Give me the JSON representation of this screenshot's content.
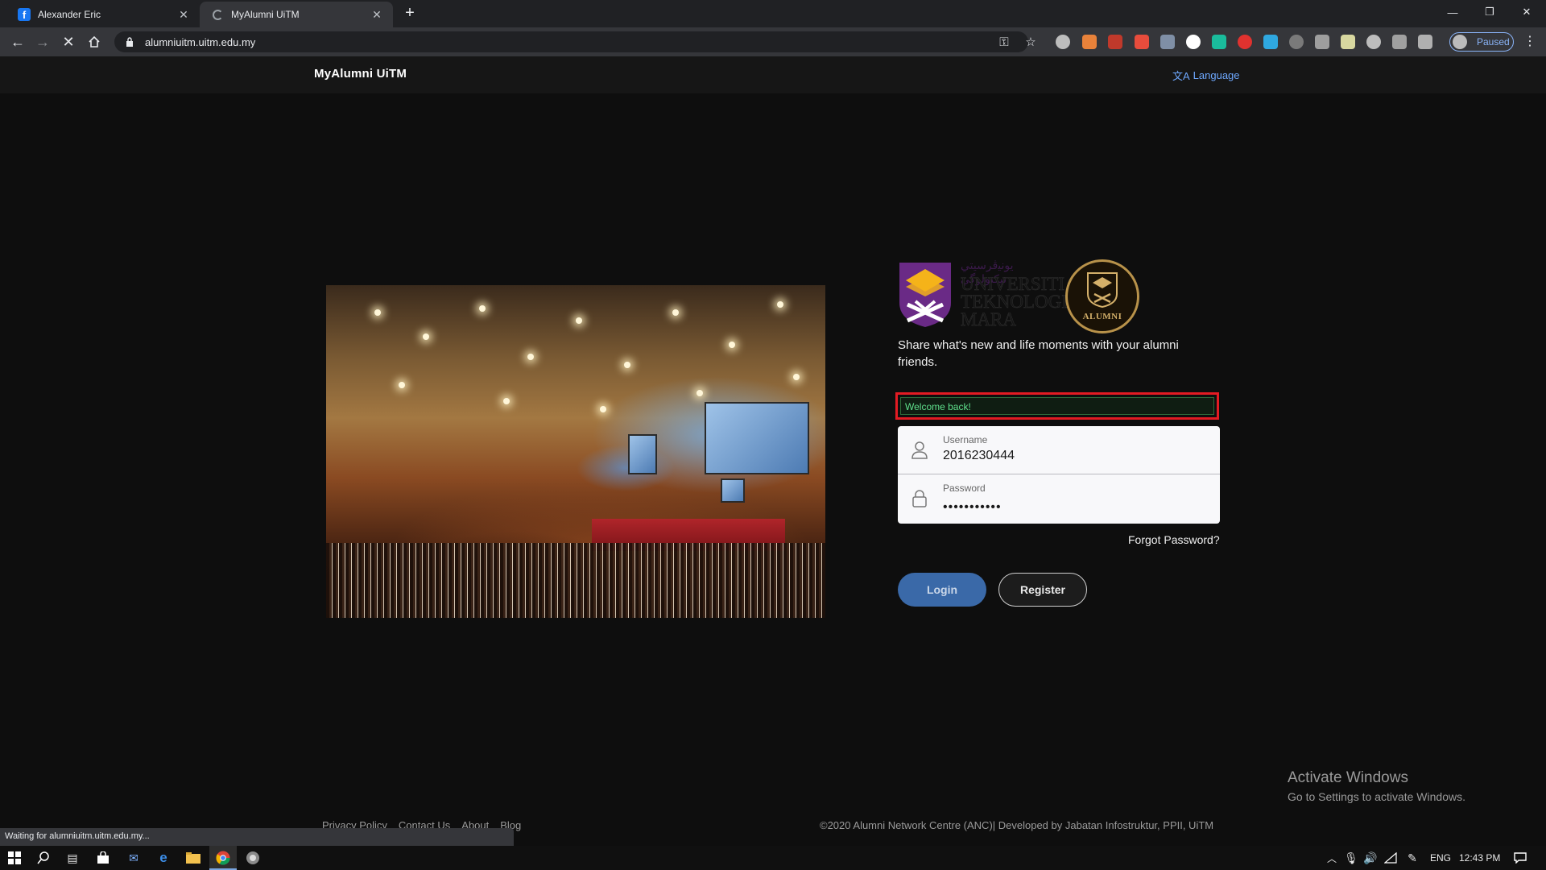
{
  "browser": {
    "tabs": [
      {
        "title": "Alexander Eric",
        "icon": "facebook-icon"
      },
      {
        "title": "MyAlumni UiTM",
        "icon": "loading-spinner-icon"
      }
    ],
    "url": "alumniuitm.uitm.edu.my",
    "profile_label": "Paused",
    "status_text": "Waiting for alumniuitm.uitm.edu.my..."
  },
  "header": {
    "brand": "MyAlumni UiTM",
    "language": "Language"
  },
  "logos": {
    "uitm_lines": [
      "UNIVERSITI",
      "TEKNOLOGI",
      "MARA"
    ],
    "alumni_seal": "ALUMNI"
  },
  "main": {
    "tagline": "Share what's new and life moments with your alumni friends.",
    "alert": "Welcome back!",
    "username_label": "Username",
    "username_value": "2016230444",
    "password_label": "Password",
    "password_value": "•••••••••••",
    "forgot_password": "Forgot Password?",
    "login_button": "Login",
    "register_button": "Register"
  },
  "footer": {
    "links": [
      "Privacy Policy",
      "Contact Us",
      "About",
      "Blog"
    ],
    "copyright": "©2020 Alumni Network Centre (ANC)| Developed by Jabatan Infostruktur, PPII, UiTM"
  },
  "watermark": {
    "title": "Activate Windows",
    "subtitle": "Go to Settings to activate Windows."
  },
  "taskbar": {
    "language": "ENG",
    "time": "12:43 PM"
  },
  "colors": {
    "accent_link": "#6ea8fe",
    "alert_border": "#e21b23",
    "alert_text": "#5fe08c",
    "login_button": "#3a69a8"
  }
}
